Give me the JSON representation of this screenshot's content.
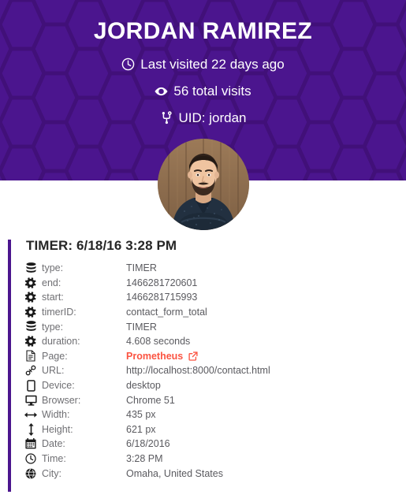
{
  "hero": {
    "name": "JORDAN RAMIREZ",
    "stats": [
      {
        "icon": "clock-icon",
        "text": "Last visited 22 days ago"
      },
      {
        "icon": "eye-icon",
        "text": "56 total visits"
      },
      {
        "icon": "code-fork-icon",
        "text": "UID: jordan"
      }
    ],
    "avatar_alt": "Jordan Ramirez profile photo",
    "background_color": "#4b158e",
    "pattern": "hexagon-honeycomb"
  },
  "card": {
    "title": "TIMER: 6/18/16 3:28 PM",
    "accent_color": "#4b158e",
    "link_color": "#fb5442",
    "rows": [
      {
        "icon": "database-icon",
        "label": "type:",
        "value": "TIMER",
        "is_link": false
      },
      {
        "icon": "gear-icon",
        "label": "end:",
        "value": "1466281720601",
        "is_link": false
      },
      {
        "icon": "gear-icon",
        "label": "start:",
        "value": "1466281715993",
        "is_link": false
      },
      {
        "icon": "gear-icon",
        "label": "timerID:",
        "value": "contact_form_total",
        "is_link": false
      },
      {
        "icon": "database-icon",
        "label": "type:",
        "value": "TIMER",
        "is_link": false
      },
      {
        "icon": "gear-icon",
        "label": "duration:",
        "value": "4.608 seconds",
        "is_link": false
      },
      {
        "icon": "file-icon",
        "label": "Page:",
        "value": "Prometheus",
        "is_link": true
      },
      {
        "icon": "link-icon",
        "label": "URL:",
        "value": "http://localhost:8000/contact.html",
        "is_link": false
      },
      {
        "icon": "mobile-icon",
        "label": "Device:",
        "value": "desktop",
        "is_link": false
      },
      {
        "icon": "desktop-icon",
        "label": "Browser:",
        "value": "Chrome 51",
        "is_link": false
      },
      {
        "icon": "arrows-h-icon",
        "label": "Width:",
        "value": "435 px",
        "is_link": false
      },
      {
        "icon": "arrows-v-icon",
        "label": "Height:",
        "value": "621 px",
        "is_link": false
      },
      {
        "icon": "calendar-icon",
        "label": "Date:",
        "value": "6/18/2016",
        "is_link": false
      },
      {
        "icon": "clock-icon",
        "label": "Time:",
        "value": "3:28 PM",
        "is_link": false
      },
      {
        "icon": "globe-icon",
        "label": "City:",
        "value": "Omaha, United States",
        "is_link": false
      }
    ]
  }
}
